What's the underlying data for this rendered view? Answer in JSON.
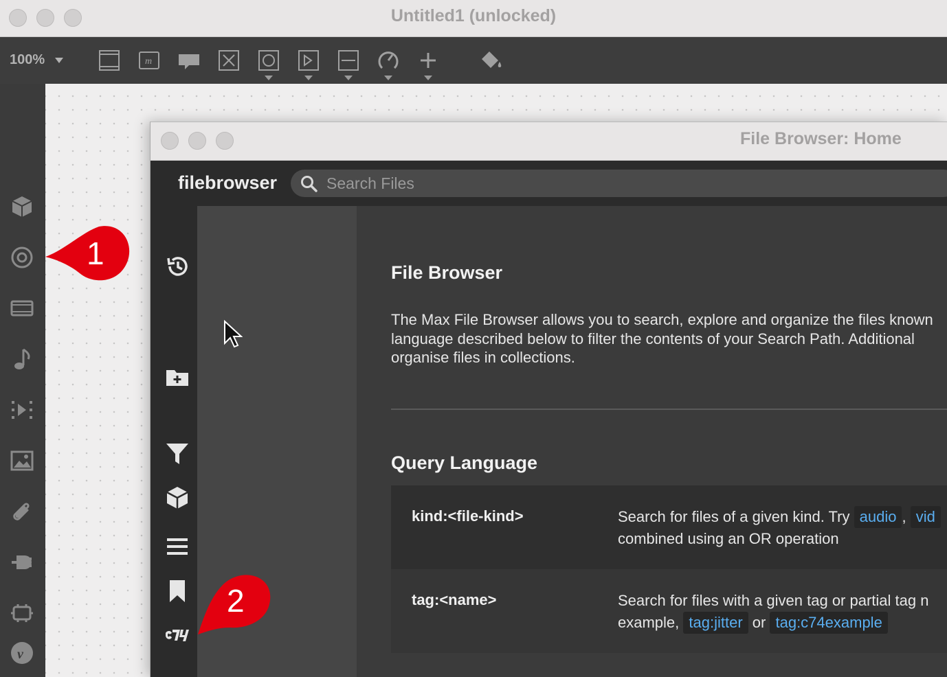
{
  "window": {
    "title": "Untitled1 (unlocked)",
    "zoom": "100%"
  },
  "toolbar": {
    "tools": [
      {
        "name": "panel-icon"
      },
      {
        "name": "message-icon"
      },
      {
        "name": "comment-icon"
      },
      {
        "name": "toggle-icon"
      },
      {
        "name": "button-icon"
      },
      {
        "name": "number-icon"
      },
      {
        "name": "slider-icon"
      },
      {
        "name": "dial-icon"
      },
      {
        "name": "add-icon"
      },
      {
        "name": "paint-bucket-icon"
      }
    ]
  },
  "left_sidebar": {
    "icons": [
      "package-icon",
      "target-icon",
      "film-icon",
      "music-note-icon",
      "video-icon",
      "image-icon",
      "paperclip-icon",
      "plug-icon",
      "hardware-icon",
      "vimeo-icon"
    ]
  },
  "file_browser": {
    "title": "File Browser: Home",
    "brand": "filebrowser",
    "search": {
      "placeholder": "Search Files",
      "value": ""
    },
    "rail_icons": [
      "history-icon",
      "new-folder-icon",
      "filter-icon",
      "package-icon",
      "list-icon",
      "bookmark-icon",
      "c74-logo-icon"
    ],
    "content": {
      "heading": "File Browser",
      "intro_lines": [
        "The Max File Browser allows you to search, explore and organize the files known",
        "language described below to filter the contents of your Search Path. Additional",
        "organise files in collections."
      ],
      "query_heading": "Query Language",
      "rows": [
        {
          "key": "kind:<file-kind>",
          "line1_text": "Search for files of a given kind. Try",
          "line1_code1": "audio",
          "line1_sep": ",",
          "line1_code2": "vid",
          "line2": "combined using an OR operation"
        },
        {
          "key": "tag:<name>",
          "line1": "Search for files with a given tag or partial tag n",
          "line2_text": "example,",
          "line2_code1": "tag:jitter",
          "line2_or": "or",
          "line2_code2": "tag:c74example"
        }
      ]
    }
  },
  "callouts": [
    {
      "label": "1",
      "color": "#e3000f"
    },
    {
      "label": "2",
      "color": "#e3000f"
    }
  ]
}
